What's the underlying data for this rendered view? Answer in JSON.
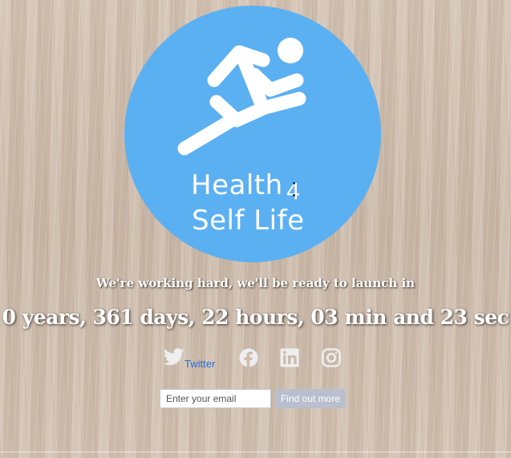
{
  "logo": {
    "line1": "Health",
    "four": "4",
    "line2": "Self Life",
    "circle_color": "#5bb0f2"
  },
  "tagline": "We're working hard, we'll be ready to launch in",
  "countdown": {
    "text": "0 years, 361 days, 22 hours, 03 min and 23 sec"
  },
  "social": {
    "twitter_label": "Twitter",
    "icons": [
      "twitter-icon",
      "facebook-icon",
      "linkedin-icon",
      "instagram-icon"
    ]
  },
  "signup": {
    "email_placeholder": "Enter your email",
    "email_value": "",
    "button_label": "Find out more"
  },
  "colors": {
    "link": "#2a6fd6",
    "button_bg": "#b9bfcd",
    "icon": "#eeeeee"
  }
}
